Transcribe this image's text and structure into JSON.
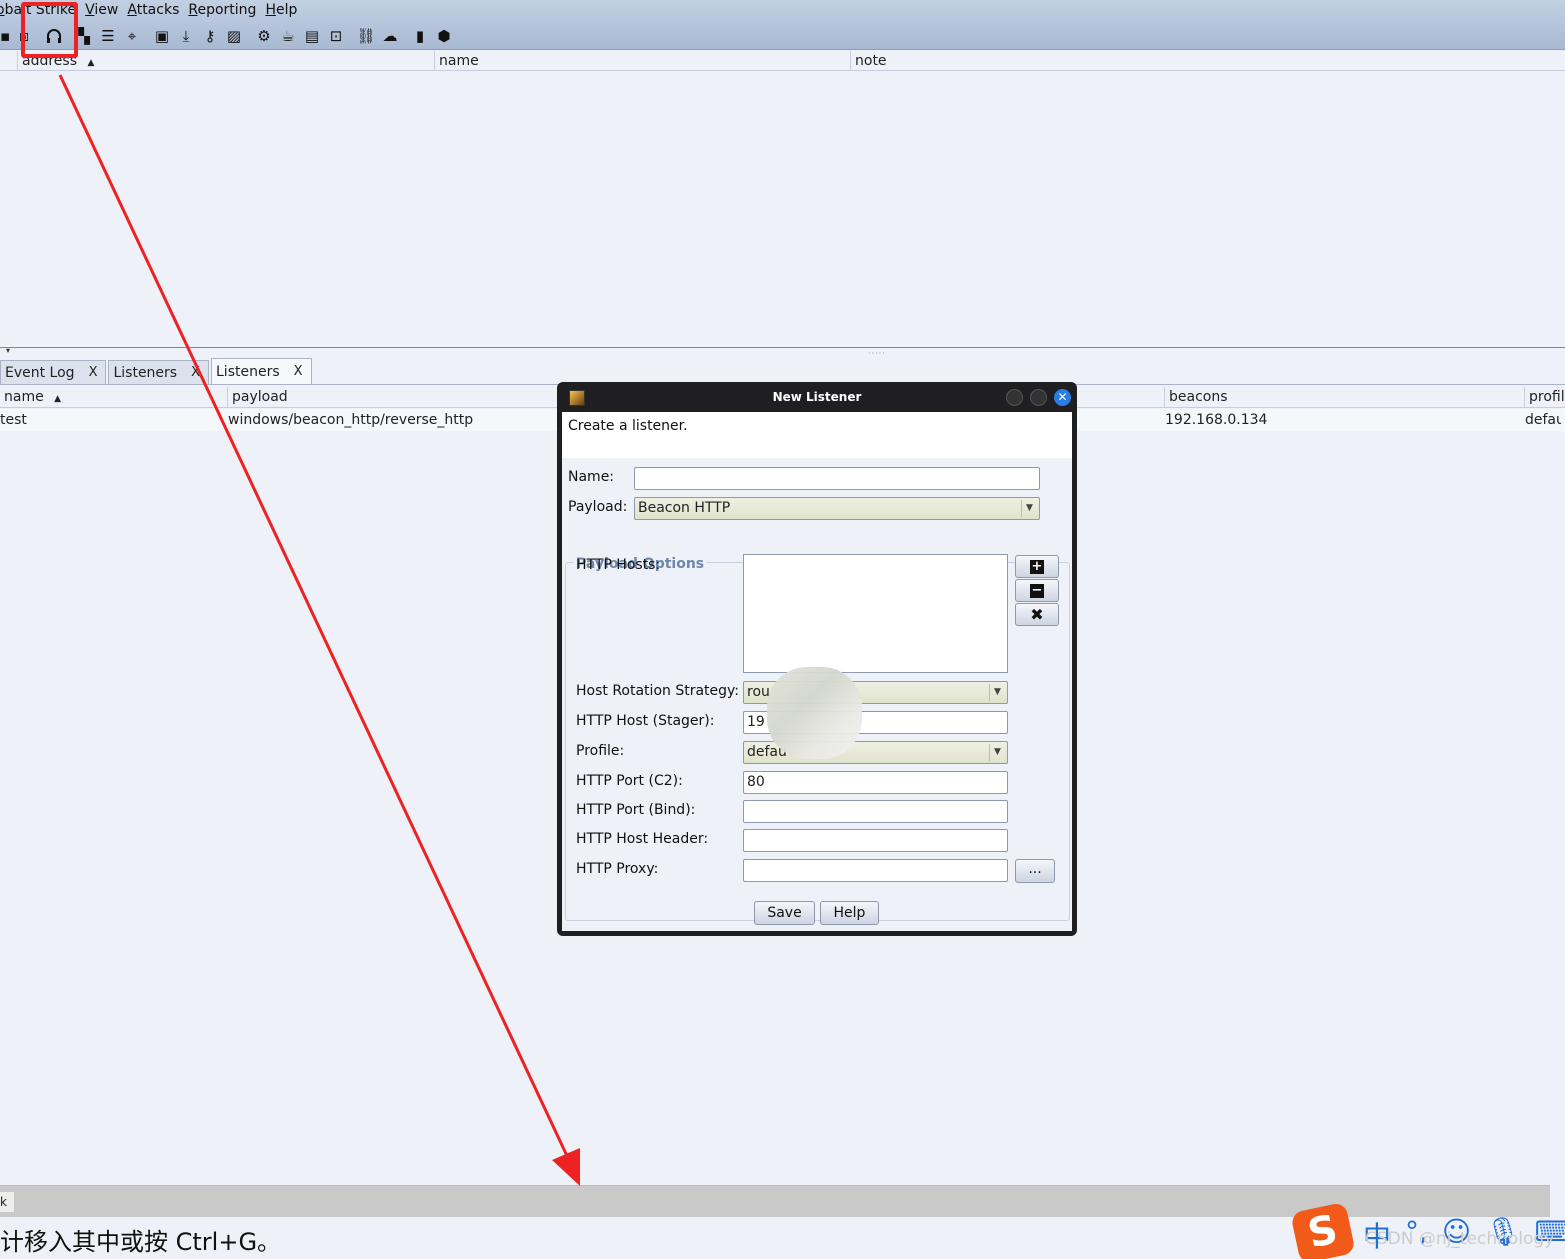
{
  "menu": [
    "obalt Strike",
    "View",
    "Attacks",
    "Reporting",
    "Help"
  ],
  "toolbar_icons": [
    "disconnect-icon",
    "preferences-icon",
    "headset-listeners-icon",
    "pivot-graph-icon",
    "session-table-icon",
    "target-table-icon",
    "credentials-icon",
    "downloads-icon",
    "keystrokes-icon",
    "screenshots-icon",
    "payload-generator-icon",
    "java-applet-icon",
    "document-icon",
    "console-icon",
    "link-icon",
    "cloud-icon",
    "manual-icon",
    "package-icon"
  ],
  "top_table": {
    "columns": [
      "address",
      "name",
      "note"
    ]
  },
  "tabs": [
    {
      "label": "Event Log",
      "close": "X"
    },
    {
      "label": "Listeners",
      "close": "X"
    },
    {
      "label": "Listeners",
      "close": "X"
    }
  ],
  "listeners_table": {
    "columns": [
      "name",
      "payload",
      "beacons",
      "profile"
    ],
    "rows": [
      {
        "name": "test",
        "payload": "windows/beacon_http/reverse_http",
        "beacons": "192.168.0.134",
        "profile": "default"
      }
    ]
  },
  "dialog": {
    "title": "New Listener",
    "description": "Create a listener.",
    "name_label": "Name:",
    "name_value": "",
    "payload_label": "Payload:",
    "payload_value": "Beacon HTTP",
    "group_title": "Payload Options",
    "http_hosts_label": "HTTP Hosts:",
    "add_symbol": "+",
    "remove_symbol": "−",
    "clear_symbol": "✖",
    "rotation_label": "Host Rotation Strategy:",
    "rotation_value": "rou",
    "stager_label": "HTTP Host (Stager):",
    "stager_value": "19",
    "profile_label": "Profile:",
    "profile_value": "defau",
    "port_c2_label": "HTTP Port (C2):",
    "port_c2_value": "80",
    "port_bind_label": "HTTP Port (Bind):",
    "port_bind_value": "",
    "host_header_label": "HTTP Host Header:",
    "host_header_value": "",
    "proxy_label": "HTTP Proxy:",
    "proxy_value": "",
    "proxy_button": "...",
    "save_button": "Save",
    "help_button": "Help"
  },
  "status": {
    "left": "k",
    "hint": "计移入其中或按 Ctrl+G。"
  },
  "ime": {
    "logo": "S",
    "lang": "中",
    "watermark": "CSDN @nj_technology"
  },
  "annotation_color": "#ee2222"
}
